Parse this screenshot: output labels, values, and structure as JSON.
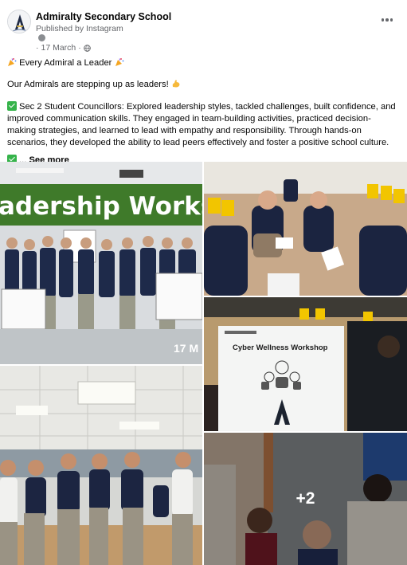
{
  "post": {
    "page_name": "Admiralty Secondary School",
    "published_by": "Published by Instagram",
    "date": "17 March",
    "separator": "·",
    "headline": "Every Admiral a Leader",
    "intro": "Our Admirals are stepping up as leaders!",
    "body": "Sec 2 Student Councillors: Explored leadership styles, tackled challenges, built confidence, and improved communication skills. They engaged in team-building activities, practiced decision-making strategies, and learned to lead with empathy and responsibility. Through hands-on scenarios, they developed the ability to lead peers effectively and foster a positive school culture.",
    "truncated_prefix": "...",
    "see_more": "See more"
  },
  "icons": {
    "avatar": "school-crest-icon",
    "badge": "audience-badge-icon",
    "globe": "globe-icon",
    "more": "more-options-icon",
    "party": "party-popper-icon",
    "flex": "flexed-biceps-icon",
    "check": "check-mark-icon"
  },
  "photos": {
    "photo1_banner": "adership Worksh",
    "photo1_date": "17 M",
    "photo3_title": "Cyber Wellness Workshop",
    "more_count": "+2"
  },
  "colors": {
    "text_primary": "#050505",
    "text_secondary": "#65676b",
    "check_green": "#35b34a",
    "banner_green": "#3f7a2a"
  }
}
